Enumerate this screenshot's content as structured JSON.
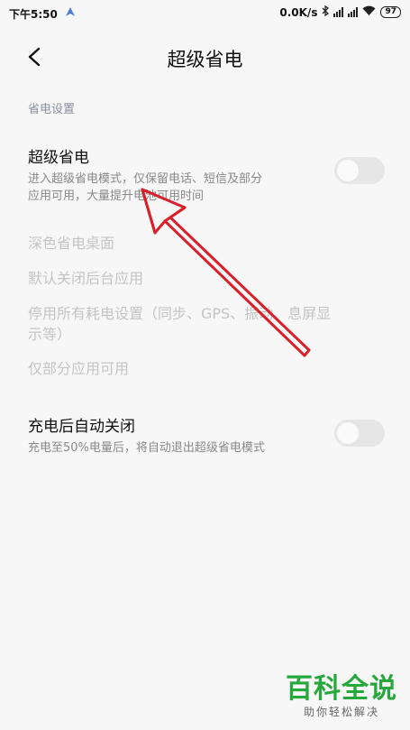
{
  "status_bar": {
    "time": "下午5:50",
    "speed": "0.0K/s",
    "battery": "97"
  },
  "header": {
    "title": "超级省电"
  },
  "section": {
    "header": "省电设置"
  },
  "super_saver": {
    "title": "超级省电",
    "desc_line1": "进入超级省电模式，仅保留电话、短信及部分",
    "desc_line2": "应用可用，大量提升电池可用时间",
    "enabled": false
  },
  "disabled_items": [
    "深色省电桌面",
    "默认关闭后台应用",
    "停用所有耗电设置（同步、GPS、振动、息屏显",
    "示等）",
    "仅部分应用可用"
  ],
  "auto_off": {
    "title": "充电后自动关闭",
    "desc": "充电至50%电量后，将自动退出超级省电模式",
    "enabled": false
  },
  "watermark": {
    "big": "百科全说",
    "small": "助你轻松解决"
  },
  "colors": {
    "annotation_arrow": "#d9202a",
    "watermark_green": "#27a83c"
  }
}
